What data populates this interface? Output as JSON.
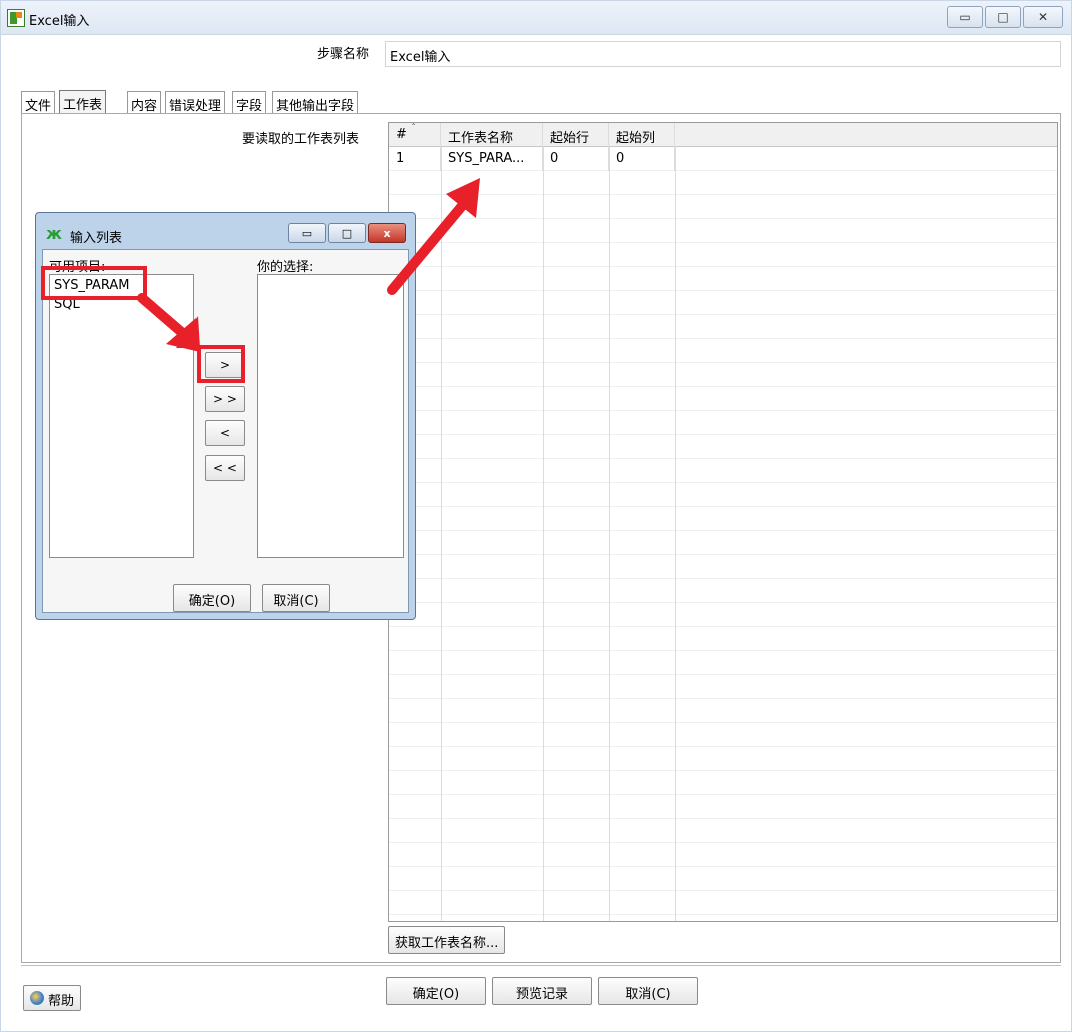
{
  "window": {
    "title": "Excel输入",
    "minimize_glyph": "▭",
    "maximize_glyph": "□",
    "close_glyph": "✕"
  },
  "step": {
    "label": "步骤名称",
    "value": "Excel输入"
  },
  "tabs": [
    {
      "label": "文件",
      "active": false
    },
    {
      "label": "工作表",
      "active": true
    },
    {
      "label": "内容",
      "active": false
    },
    {
      "label": "错误处理",
      "active": false
    },
    {
      "label": "字段",
      "active": false
    },
    {
      "label": "其他输出字段",
      "active": false
    }
  ],
  "sheet_list": {
    "label": "要读取的工作表列表",
    "sort_caret": "ˆ",
    "columns": [
      "#",
      "工作表名称",
      "起始行",
      "起始列"
    ],
    "rows": [
      [
        "1",
        "SYS_PARA...",
        "0",
        "0"
      ]
    ],
    "fetch_button": "获取工作表名称..."
  },
  "buttons": {
    "ok": "确定(O)",
    "preview": "预览记录",
    "cancel": "取消(C)",
    "help": "帮助"
  },
  "dialog": {
    "title": "输入列表",
    "icon": "ж",
    "available_label": "可用项目:",
    "available_items": [
      "SYS_PARAM",
      "SQL"
    ],
    "selected_label": "你的选择:",
    "add_one": ">",
    "add_all": "> >",
    "remove_one": "<",
    "remove_all": "< <",
    "ok": "确定(O)",
    "cancel": "取消(C)",
    "minimize_glyph": "▭",
    "maximize_glyph": "□",
    "close_glyph": "x"
  },
  "colors": {
    "highlight": "#e8202a",
    "arrow": "#e8202a"
  }
}
